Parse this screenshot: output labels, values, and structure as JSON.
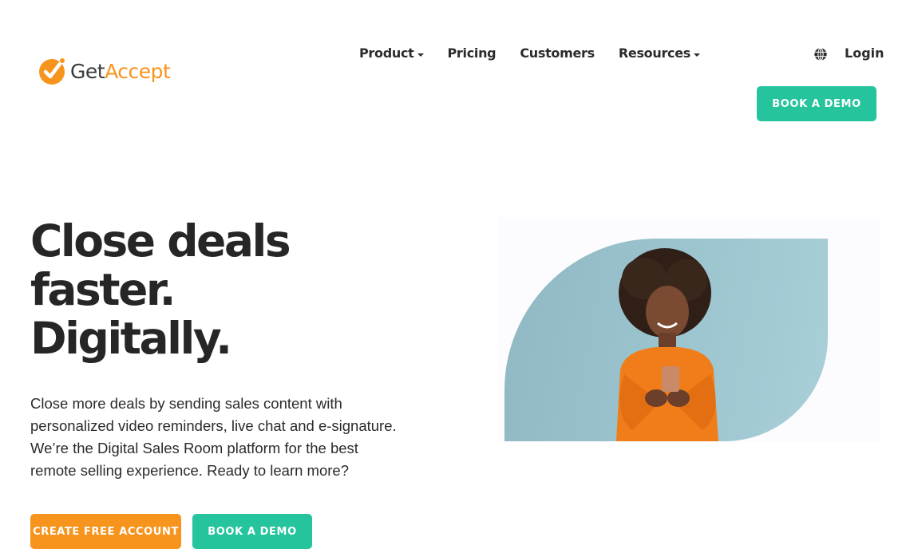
{
  "brand": {
    "name_part1": "Get",
    "name_part2": "Accept",
    "primary_color": "#f7941d",
    "accent_color": "#25c49c"
  },
  "nav": {
    "items": [
      {
        "label": "Product",
        "has_dropdown": true
      },
      {
        "label": "Pricing",
        "has_dropdown": false
      },
      {
        "label": "Customers",
        "has_dropdown": false
      },
      {
        "label": "Resources",
        "has_dropdown": true
      }
    ],
    "language_icon": "globe-icon",
    "login_label": "Login",
    "book_demo_label": "BOOK A DEMO"
  },
  "hero": {
    "title_lines": [
      "Close deals",
      "faster.",
      "Digitally."
    ],
    "description_lines": [
      "Close more deals by sending sales content with",
      "personalized video reminders, live chat and e-signature.",
      "We’re the Digital Sales Room platform for the best",
      "remote selling experience. Ready to learn more?"
    ],
    "create_account_label": "CREATE FREE ACCOUNT",
    "book_demo_label": "BOOK A DEMO",
    "image_alt": "Smiling woman in orange sweater looking at her phone"
  }
}
